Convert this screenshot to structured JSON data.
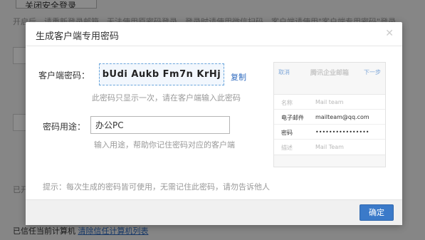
{
  "background": {
    "top_button_label": "关闭安全登录",
    "intro_text": "开启后，请重新登录邮箱，无法使用原密码登录，登录时请使用微信扫码，客户端请使用\"客户端专用密码\"登录",
    "left_fragment_1": "已开",
    "trusted_text": "已信任当前计算机",
    "clear_link": "清除信任计算机列表"
  },
  "dialog": {
    "title": "生成客户端专用密码",
    "close_icon": "close-icon",
    "password_label": "客户端密码：",
    "password_value": "bUdi Aukb Fm7n KrHj",
    "copy_label": "复制",
    "password_hint": "此密码只显示一次，请在客户端输入此密码",
    "purpose_label": "密码用途：",
    "purpose_value": "办公PC",
    "purpose_hint": "输入用途，帮助你记住密码对应的客户端",
    "tip": "提示：每次生成的密码皆可使用，无需记住此密码，请勿告诉他人",
    "ok_label": "确定"
  },
  "preview": {
    "cancel": "取消",
    "title": "腾讯企业邮箱",
    "next": "下一步",
    "rows": [
      {
        "key": "名称",
        "value": "Mail team"
      },
      {
        "key": "电子邮件",
        "value": "mailteam@qq.com"
      },
      {
        "key": "密码",
        "value": "••••••••••••••••"
      },
      {
        "key": "描述",
        "value": "Mail Team"
      }
    ]
  },
  "colors": {
    "accent": "#3b7ac9",
    "link": "#2f6bbf",
    "password_border": "#6aa6dc"
  }
}
